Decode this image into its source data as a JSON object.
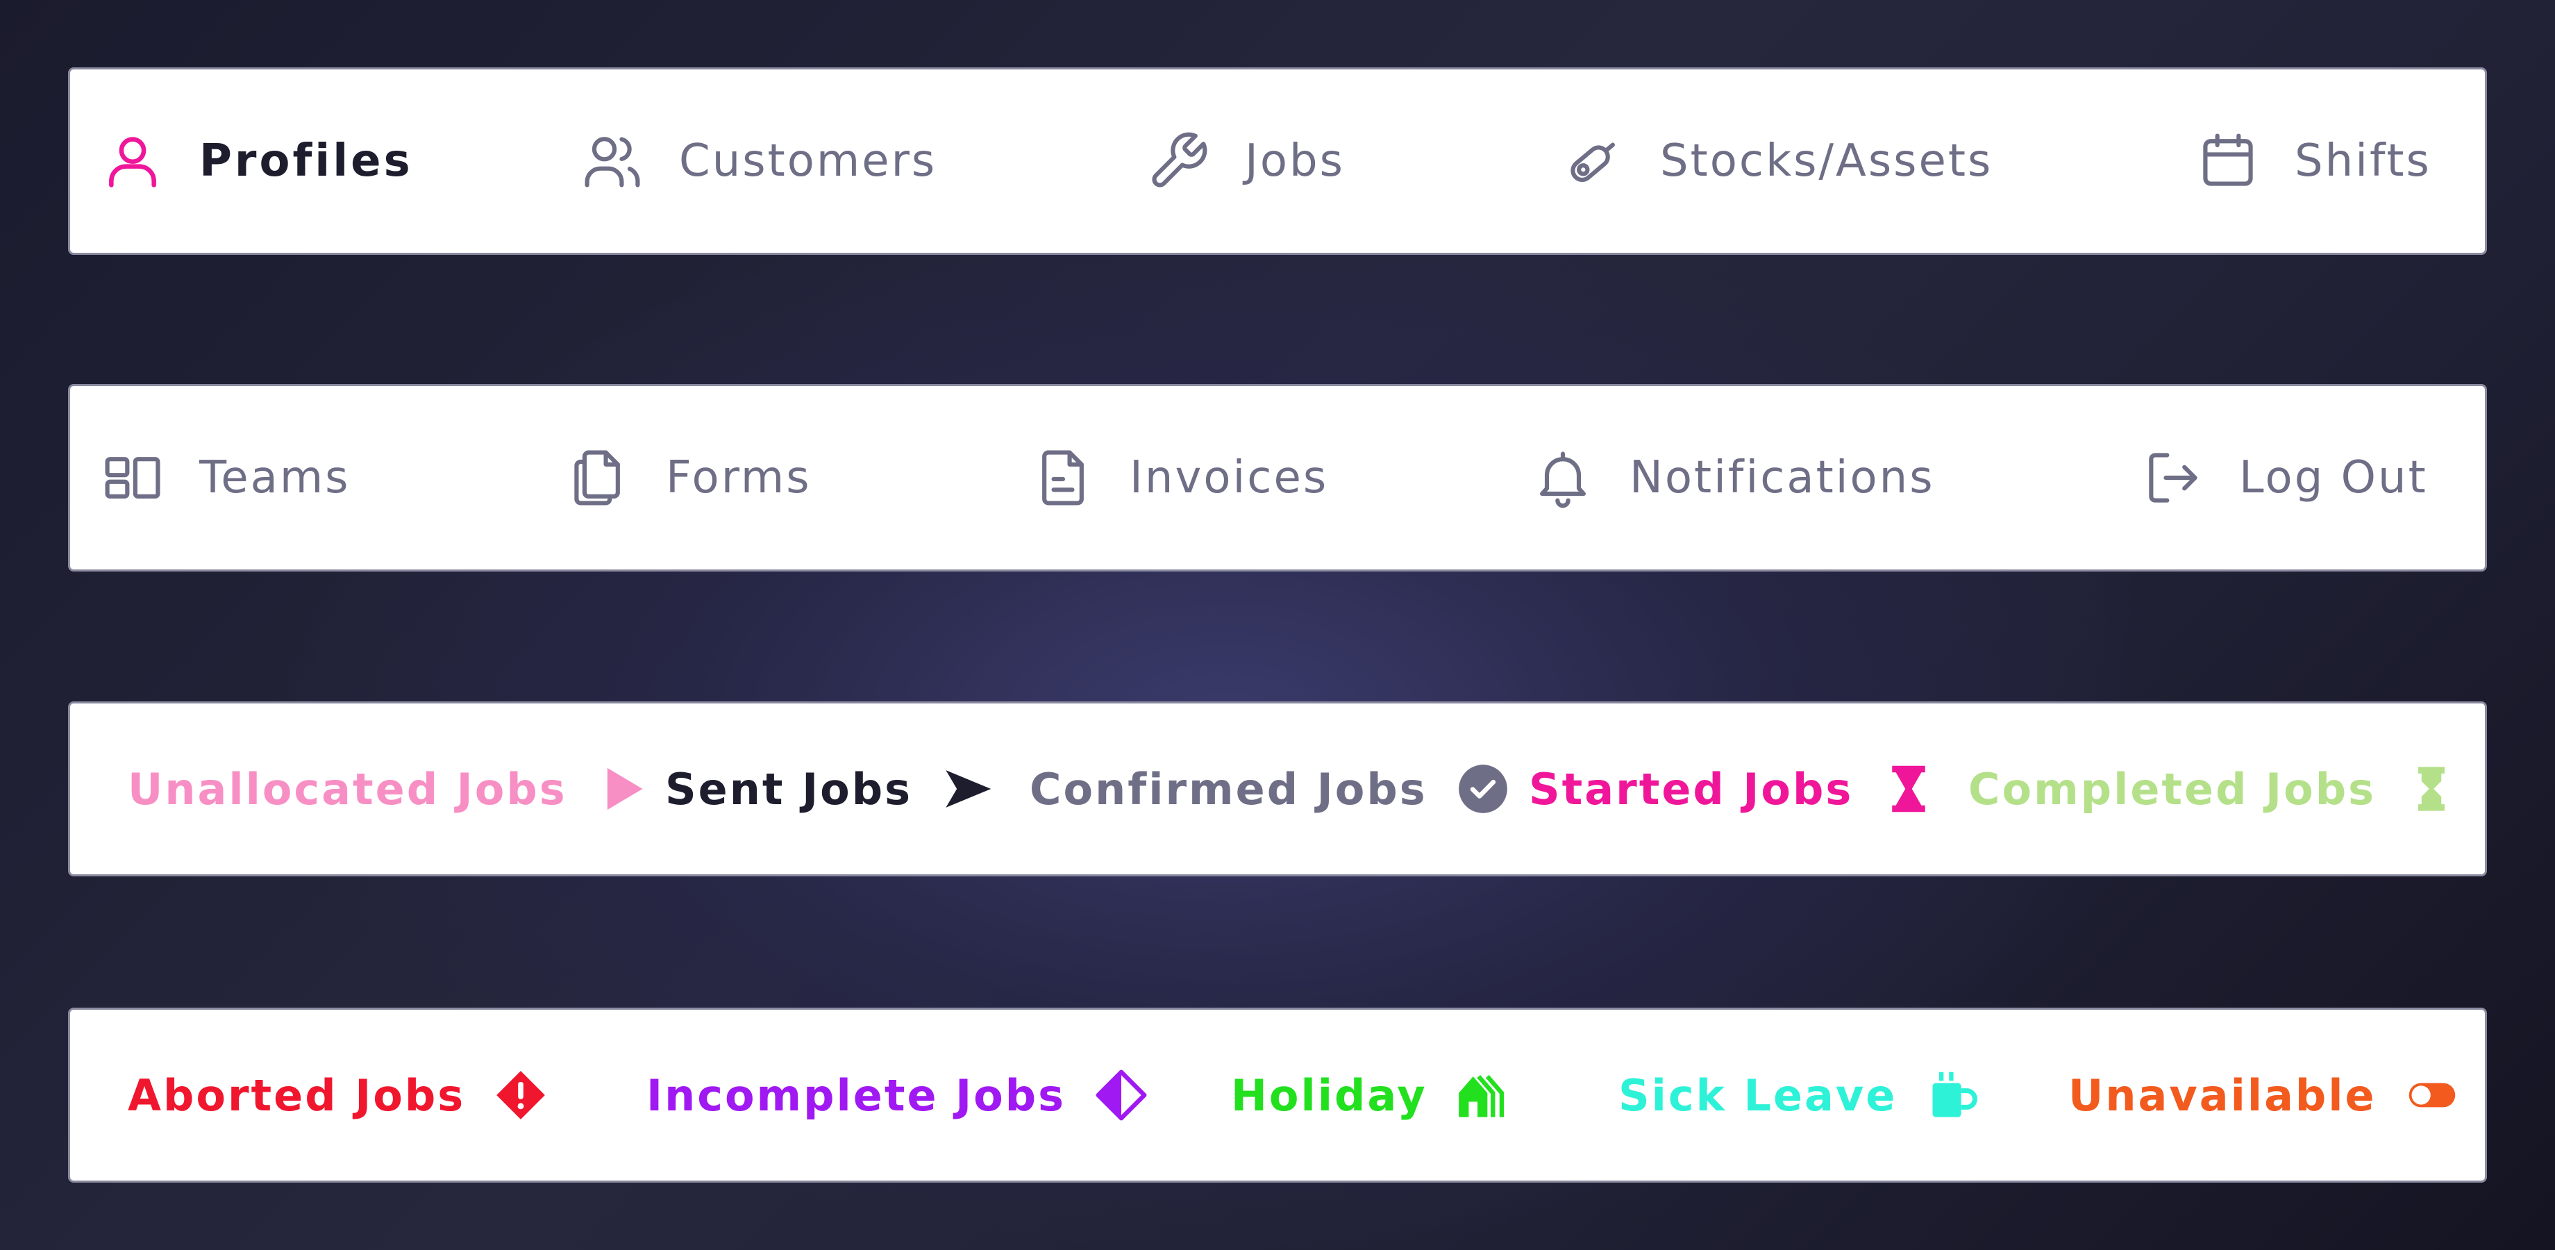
{
  "main_nav": {
    "items": [
      {
        "label": "Profiles",
        "icon": "user-icon",
        "active": true
      },
      {
        "label": "Customers",
        "icon": "users-icon"
      },
      {
        "label": "Jobs",
        "icon": "wrench-icon"
      },
      {
        "label": "Stocks/Assets",
        "icon": "cylinder-icon"
      },
      {
        "label": "Shifts",
        "icon": "calendar-icon"
      }
    ]
  },
  "secondary_nav": {
    "items": [
      {
        "label": "Teams",
        "icon": "layout-icon"
      },
      {
        "label": "Forms",
        "icon": "files-icon"
      },
      {
        "label": "Invoices",
        "icon": "document-icon"
      },
      {
        "label": "Notifications",
        "icon": "bell-icon"
      },
      {
        "label": "Log Out",
        "icon": "logout-icon"
      }
    ]
  },
  "job_statuses": {
    "items": [
      {
        "label": "Unallocated Jobs",
        "icon": "play-icon",
        "color": "#f78fc4"
      },
      {
        "label": "Sent Jobs",
        "icon": "send-arrow-icon",
        "color": "#1d1d2e"
      },
      {
        "label": "Confirmed Jobs",
        "icon": "check-circle-icon",
        "color": "#6e6e86"
      },
      {
        "label": "Started Jobs",
        "icon": "hourglass-icon",
        "color": "#f0169a"
      },
      {
        "label": "Completed Jobs",
        "icon": "hourglass-empty-icon",
        "color": "#b5e08a"
      }
    ]
  },
  "availability_statuses": {
    "items": [
      {
        "label": "Aborted Jobs",
        "icon": "alert-diamond-icon",
        "color": "#f0162e"
      },
      {
        "label": "Incomplete Jobs",
        "icon": "half-diamond-icon",
        "color": "#a018f2"
      },
      {
        "label": "Holiday",
        "icon": "holiday-house-icon",
        "color": "#22e01e"
      },
      {
        "label": "Sick Leave",
        "icon": "mug-icon",
        "color": "#2ef2d8"
      },
      {
        "label": "Unavailable",
        "icon": "toggle-off-icon",
        "color": "#f25a1e"
      }
    ]
  }
}
